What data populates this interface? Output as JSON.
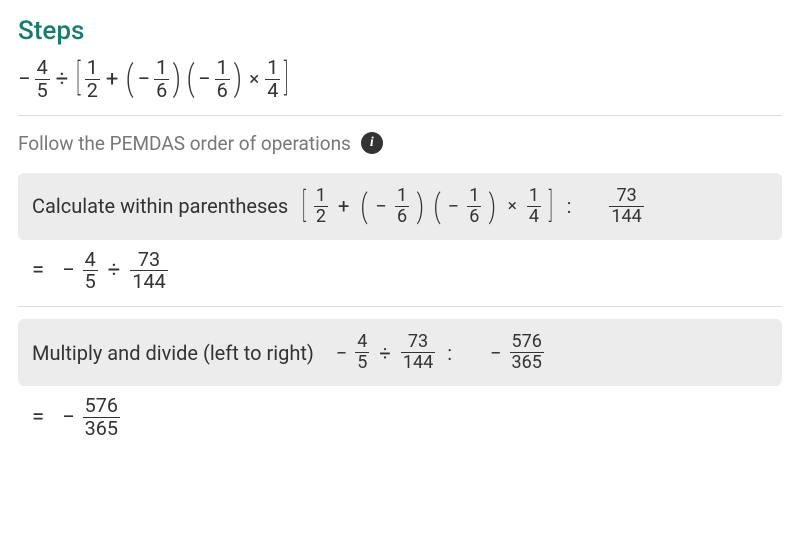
{
  "title": "Steps",
  "pemdas": "Follow the PEMDAS order of operations",
  "info_icon_label": "i",
  "ops": {
    "minus": "−",
    "plus": "+",
    "div": "÷",
    "times": "×",
    "eq": "=",
    "colon": ":"
  },
  "problem": {
    "lead_minus": "−",
    "f1": {
      "n": "4",
      "d": "5"
    },
    "bracket": {
      "t1": {
        "n": "1",
        "d": "2"
      },
      "t2_sign": "−",
      "t2": {
        "n": "1",
        "d": "6"
      },
      "t3_sign": "−",
      "t3": {
        "n": "1",
        "d": "6"
      },
      "t4": {
        "n": "1",
        "d": "4"
      }
    }
  },
  "step1": {
    "label": "Calculate within parentheses",
    "result": {
      "n": "73",
      "d": "144"
    },
    "row_result": {
      "lead_minus": "−",
      "a": {
        "n": "4",
        "d": "5"
      },
      "b": {
        "n": "73",
        "d": "144"
      }
    }
  },
  "step2": {
    "label": "Multiply and divide (left to right)",
    "expr": {
      "lead_minus": "−",
      "a": {
        "n": "4",
        "d": "5"
      },
      "b": {
        "n": "73",
        "d": "144"
      }
    },
    "result_sign": "−",
    "result": {
      "n": "576",
      "d": "365"
    }
  },
  "final": {
    "sign": "−",
    "f": {
      "n": "576",
      "d": "365"
    }
  }
}
